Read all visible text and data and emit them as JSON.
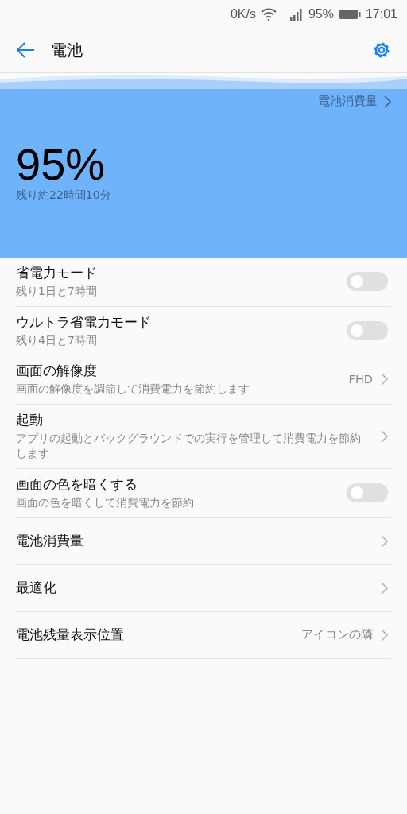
{
  "status_bar": {
    "speed": "0K/s",
    "battery": "95%",
    "time": "17:01"
  },
  "toolbar": {
    "title": "電池"
  },
  "hero": {
    "link": "電池消費量",
    "percent": "95%",
    "remaining": "残り約22時間10分"
  },
  "rows": [
    {
      "kind": "toggle",
      "title": "省電力モード",
      "subtitle": "残り1日と7時間",
      "on": false
    },
    {
      "kind": "toggle",
      "title": "ウルトラ省電力モード",
      "subtitle": "残り4日と7時間",
      "on": false
    },
    {
      "kind": "link",
      "title": "画面の解像度",
      "subtitle": "画面の解像度を調節して消費電力を節約します",
      "value": "FHD"
    },
    {
      "kind": "link",
      "title": "起動",
      "subtitle": "アプリの起動とバックグラウンドでの実行を管理して消費電力を節約します"
    },
    {
      "kind": "toggle",
      "title": "画面の色を暗くする",
      "subtitle": "画面の色を暗くして消費電力を節約",
      "on": false
    },
    {
      "kind": "link",
      "title": "電池消費量"
    },
    {
      "kind": "link",
      "title": "最適化"
    },
    {
      "kind": "link",
      "title": "電池残量表示位置",
      "value": "アイコンの隣"
    }
  ]
}
